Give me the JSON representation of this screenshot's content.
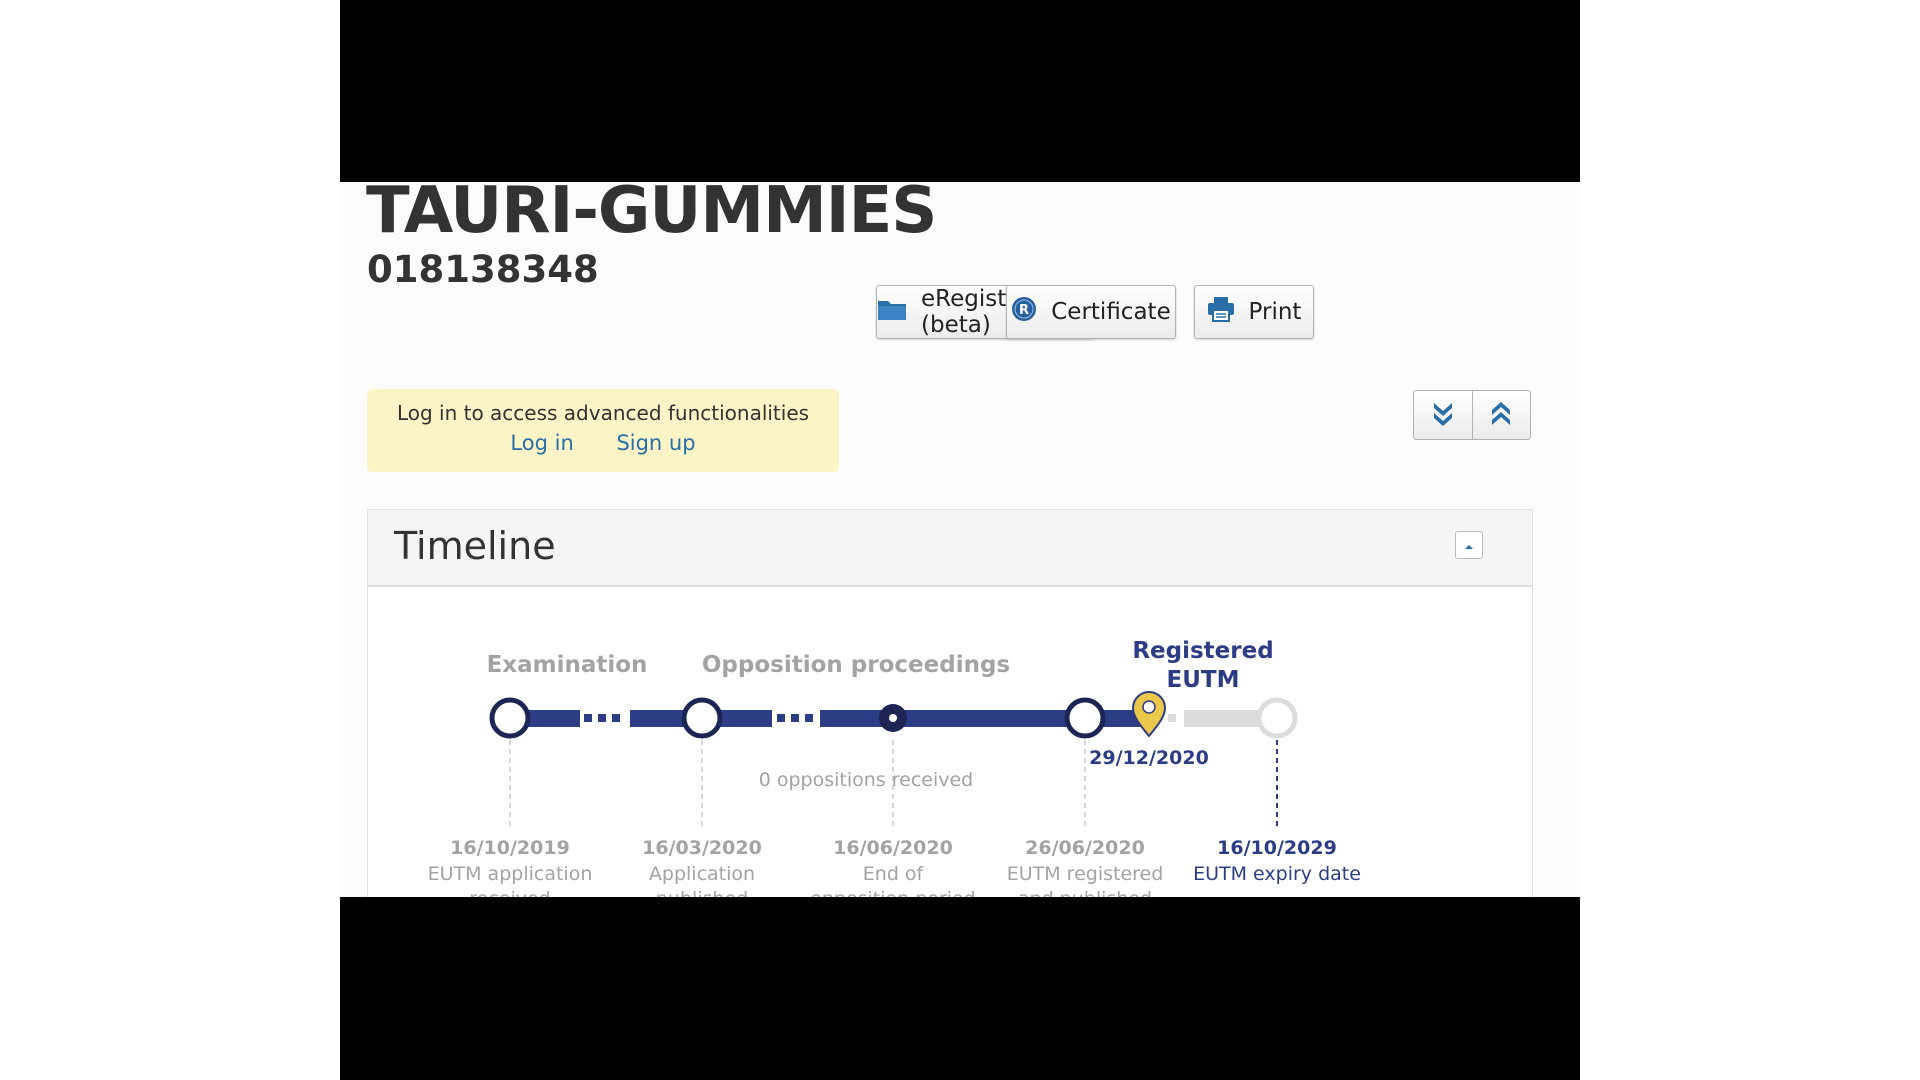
{
  "header": {
    "title": "TAURI-GUMMIES",
    "number": "018138348"
  },
  "toolbar": {
    "eregister_label": "eRegister (beta)",
    "certificate_label": "Certificate",
    "print_label": "Print"
  },
  "login_notice": {
    "text": "Log in to access advanced functionalities",
    "login_link": "Log in",
    "signup_link": "Sign up"
  },
  "timeline": {
    "title": "Timeline",
    "phases": {
      "examination": "Examination",
      "opposition": "Opposition proceedings",
      "registered_line1": "Registered",
      "registered_line2": "EUTM"
    },
    "oppositions": "0 oppositions received",
    "current_date": "29/12/2020",
    "milestones": [
      {
        "date": "16/10/2019",
        "line1": "EUTM application",
        "line2": "received"
      },
      {
        "date": "16/03/2020",
        "line1": "Application",
        "line2": "published"
      },
      {
        "date": "16/06/2020",
        "line1": "End of",
        "line2": "opposition period"
      },
      {
        "date": "26/06/2020",
        "line1": "EUTM registered",
        "line2": "and published"
      },
      {
        "date": "16/10/2029",
        "line1": "EUTM expiry date",
        "line2": ""
      }
    ]
  },
  "colors": {
    "navy": "#2c3d86",
    "node_dark": "#1c2554",
    "gray_text": "#9a9a9a",
    "marker_gold": "#ecc84a",
    "link_blue": "#2a6ea8",
    "notice_bg": "#fbf4c6"
  },
  "icons": {
    "eregister": "folder-icon",
    "certificate": "registered-icon",
    "print": "printer-icon",
    "expand": "expand-all-icon",
    "collapse": "collapse-all-icon",
    "panel_collapse": "caret-up-icon",
    "current_marker": "map-pin-icon"
  }
}
